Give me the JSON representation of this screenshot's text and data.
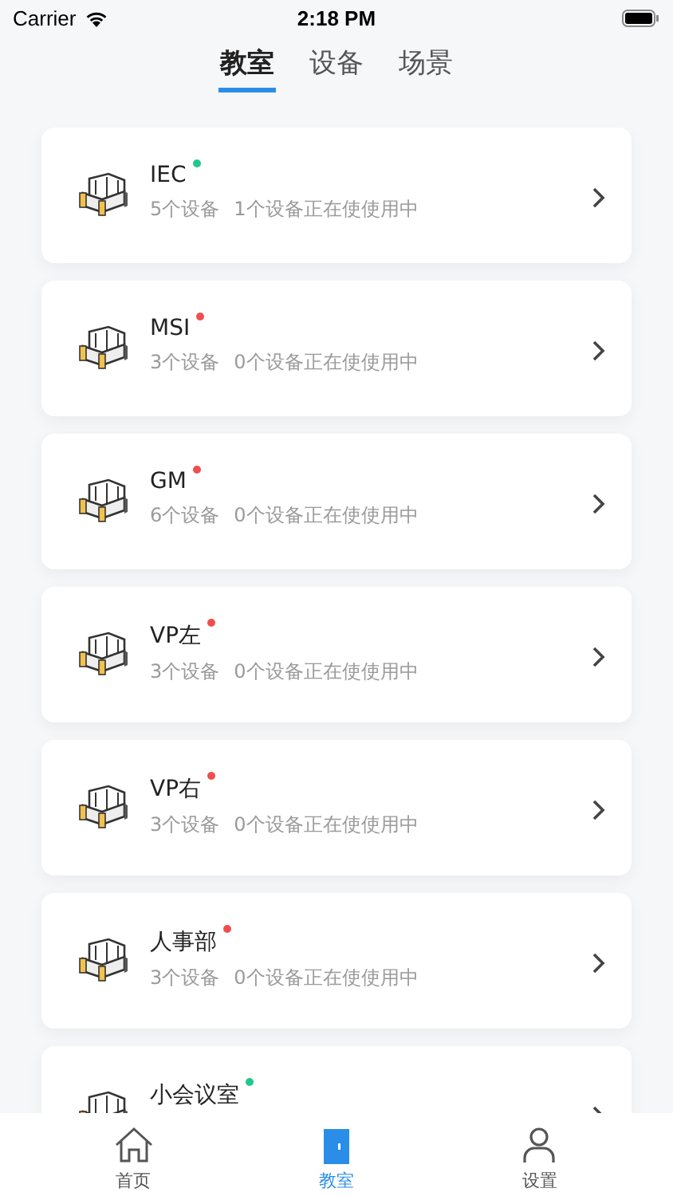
{
  "status_bar": {
    "carrier": "Carrier",
    "time": "2:18 PM"
  },
  "tabs": [
    {
      "label": "教室",
      "selected": true
    },
    {
      "label": "设备",
      "selected": false
    },
    {
      "label": "场景",
      "selected": false
    }
  ],
  "rooms": [
    {
      "name": "IEC",
      "color": "#1fc98a",
      "devices": "5个设备",
      "in_use": "1个设备正在使使用中"
    },
    {
      "name": "MSI",
      "color": "#f04e4e",
      "devices": "3个设备",
      "in_use": "0个设备正在使使用中"
    },
    {
      "name": "GM",
      "color": "#f04e4e",
      "devices": "6个设备",
      "in_use": "0个设备正在使使用中"
    },
    {
      "name": "VP左",
      "color": "#f04e4e",
      "devices": "3个设备",
      "in_use": "0个设备正在使使用中"
    },
    {
      "name": "VP右",
      "color": "#f04e4e",
      "devices": "3个设备",
      "in_use": "0个设备正在使使用中"
    },
    {
      "name": "人事部",
      "color": "#f04e4e",
      "devices": "3个设备",
      "in_use": "0个设备正在使使用中"
    },
    {
      "name": "小会议室",
      "color": "#1fc98a"
    }
  ],
  "tab_bar": [
    {
      "kind": "home",
      "label": "首页",
      "selected": false
    },
    {
      "kind": "room",
      "label": "教室",
      "selected": true
    },
    {
      "kind": "user",
      "label": "设置",
      "selected": false
    }
  ]
}
